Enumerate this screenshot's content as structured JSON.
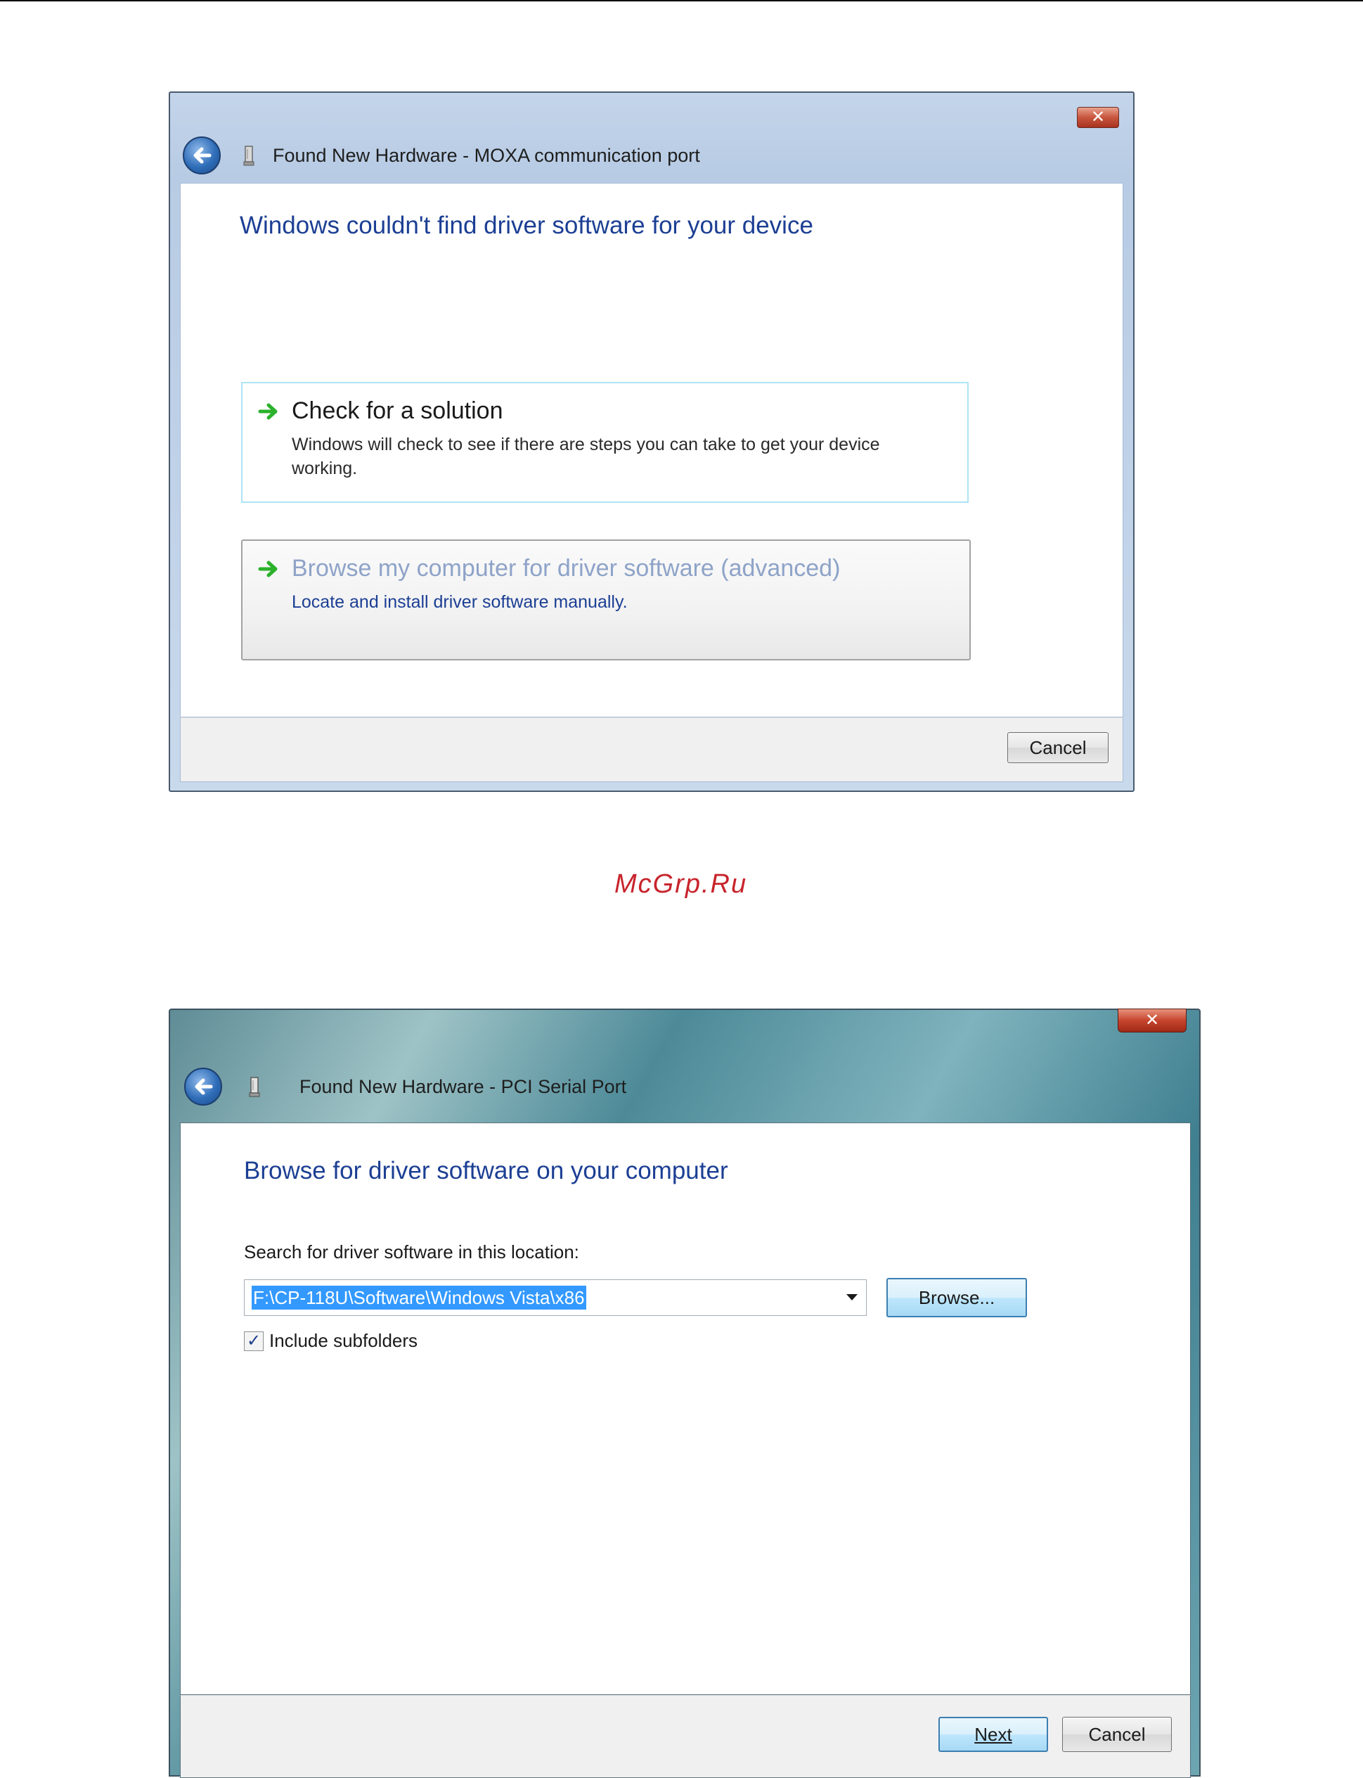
{
  "dialog1": {
    "title": "Found New Hardware - MOXA communication port",
    "close_label": "✕",
    "heading": "Windows couldn't find driver software for your device",
    "options": [
      {
        "title": "Check for a solution",
        "description": "Windows will check to see if there are steps you can take to get your device working."
      },
      {
        "title": "Browse my computer for driver software (advanced)",
        "description": "Locate and install driver software manually."
      }
    ],
    "cancel_label": "Cancel"
  },
  "watermark": "McGrp.Ru",
  "dialog2": {
    "title": "Found New Hardware - PCI Serial Port",
    "close_label": "✕",
    "heading": "Browse for driver software on your computer",
    "search_label": "Search for driver software in this location:",
    "location_value": "F:\\CP-118U\\Software\\Windows Vista\\x86",
    "browse_label": "Browse...",
    "include_subfolders_label": "Include subfolders",
    "include_subfolders_checked": true,
    "checkmark": "✓",
    "next_label": "Next",
    "cancel_label": "Cancel"
  },
  "icons": {
    "back": "back-arrow-icon",
    "device": "hardware-device-icon",
    "option_arrow": "green-arrow-icon",
    "close": "close-icon",
    "dropdown": "chevron-down-icon"
  },
  "colors": {
    "heading_blue": "#1c3f94",
    "watermark_red": "#c8242c",
    "selection_blue": "#3399ff",
    "arrow_green": "#2bb12b"
  }
}
